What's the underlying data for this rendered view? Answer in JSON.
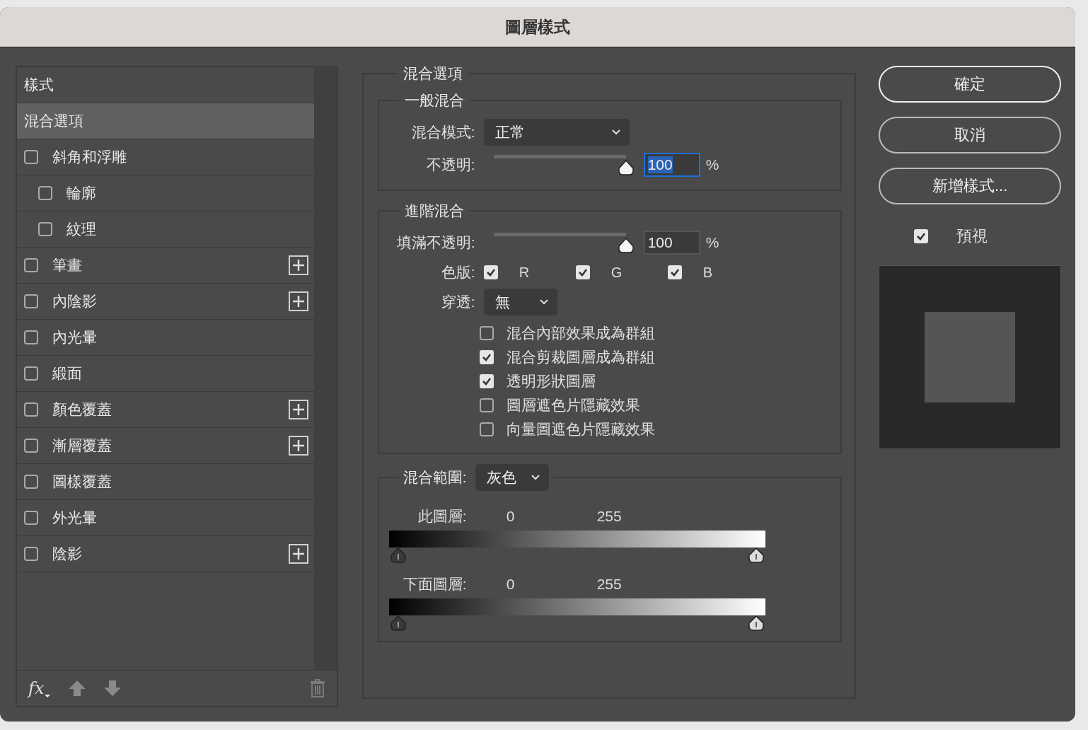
{
  "dialog": {
    "title": "圖層樣式"
  },
  "styles_list": {
    "items": [
      {
        "kind": "header",
        "label": "樣式",
        "selected": false
      },
      {
        "kind": "header",
        "label": "混合選項",
        "selected": true
      },
      {
        "kind": "effect",
        "label": "斜角和浮雕",
        "checked": false,
        "selected": false,
        "add_button": false,
        "children": [
          {
            "kind": "effect",
            "label": "輪廓",
            "checked": false,
            "selected": false,
            "add_button": false
          },
          {
            "kind": "effect",
            "label": "紋理",
            "checked": false,
            "selected": false,
            "add_button": false
          }
        ]
      },
      {
        "kind": "effect",
        "label": "筆畫",
        "checked": false,
        "selected": false,
        "add_button": true
      },
      {
        "kind": "effect",
        "label": "內陰影",
        "checked": false,
        "selected": false,
        "add_button": true
      },
      {
        "kind": "effect",
        "label": "內光暈",
        "checked": false,
        "selected": false,
        "add_button": false
      },
      {
        "kind": "effect",
        "label": "緞面",
        "checked": false,
        "selected": false,
        "add_button": false
      },
      {
        "kind": "effect",
        "label": "顏色覆蓋",
        "checked": false,
        "selected": false,
        "add_button": true
      },
      {
        "kind": "effect",
        "label": "漸層覆蓋",
        "checked": false,
        "selected": false,
        "add_button": true
      },
      {
        "kind": "effect",
        "label": "圖樣覆蓋",
        "checked": false,
        "selected": false,
        "add_button": false
      },
      {
        "kind": "effect",
        "label": "外光暈",
        "checked": false,
        "selected": false,
        "add_button": false
      },
      {
        "kind": "effect",
        "label": "陰影",
        "checked": false,
        "selected": false,
        "add_button": true
      }
    ],
    "footer": {
      "fx_label": "fx"
    }
  },
  "blending_options": {
    "title": "混合選項",
    "general": {
      "title": "一般混合",
      "blend_mode": {
        "label": "混合模式:",
        "value": "正常"
      },
      "opacity": {
        "label": "不透明:",
        "level": 1,
        "value": "100",
        "unit": "%",
        "focused": true
      }
    },
    "advanced": {
      "title": "進階混合",
      "fill_opacity": {
        "label": "填滿不透明:",
        "level": 1,
        "value": "100",
        "unit": "%",
        "focused": false
      },
      "channels": {
        "label": "色版:",
        "items": [
          {
            "label": "R",
            "checked": true
          },
          {
            "label": "G",
            "checked": true
          },
          {
            "label": "B",
            "checked": true
          }
        ]
      },
      "knockout": {
        "label": "穿透:",
        "value": "無"
      },
      "options": [
        {
          "label": "混合內部效果成為群組",
          "checked": false
        },
        {
          "label": "混合剪裁圖層成為群組",
          "checked": true
        },
        {
          "label": "透明形狀圖層",
          "checked": true
        },
        {
          "label": "圖層遮色片隱藏效果",
          "checked": false
        },
        {
          "label": "向量圖遮色片隱藏效果",
          "checked": false
        }
      ]
    },
    "blend_if": {
      "label": "混合範圍:",
      "value": "灰色",
      "ranges": [
        {
          "label": "此圖層:",
          "low": "0",
          "high": "255",
          "thumbs": [
            {
              "level": 0
            },
            {
              "level": 1
            }
          ]
        },
        {
          "label": "下面圖層:",
          "low": "0",
          "high": "255",
          "thumbs": [
            {
              "level": 0
            },
            {
              "level": 1
            }
          ]
        }
      ]
    }
  },
  "buttons": [
    {
      "label": "確定",
      "default": true
    },
    {
      "label": "取消",
      "default": false
    },
    {
      "label": "新增樣式...",
      "default": false
    }
  ],
  "preview": {
    "label": "預視",
    "checked": true
  }
}
